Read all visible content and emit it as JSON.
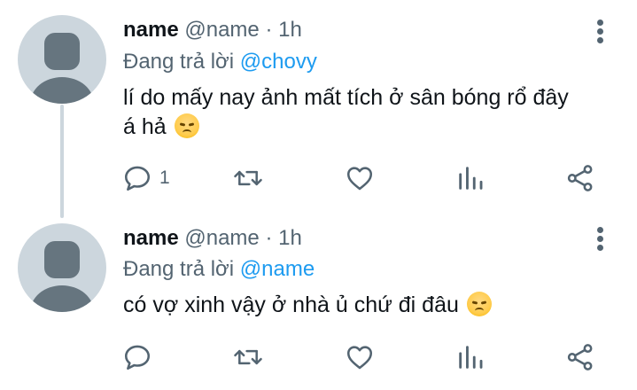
{
  "tweets": [
    {
      "author_name": "name",
      "handle": "@name",
      "separator": "·",
      "time": "1h",
      "reply_prefix": "Đang trả lời",
      "reply_mention": "@chovy",
      "text": "lí do mấy nay ảnh mất tích ở sân bóng rổ đây á hả",
      "emoji": "disappointed-face",
      "reply_count": "1"
    },
    {
      "author_name": "name",
      "handle": "@name",
      "separator": "·",
      "time": "1h",
      "reply_prefix": "Đang trả lời",
      "reply_mention": "@name",
      "text": "có vợ xinh vậy ở nhà ủ chứ đi đâu",
      "emoji": "disappointed-face",
      "reply_count": ""
    }
  ],
  "icons": {
    "reply": "reply-icon",
    "retweet": "retweet-icon",
    "like": "heart-icon",
    "stats": "analytics-icon",
    "share": "share-icon",
    "more": "more-vertical-icon"
  },
  "colors": {
    "mention": "#1d9bf0",
    "muted": "#536471",
    "avatar_bg": "#ccd6dd",
    "avatar_fg": "#66757f"
  }
}
